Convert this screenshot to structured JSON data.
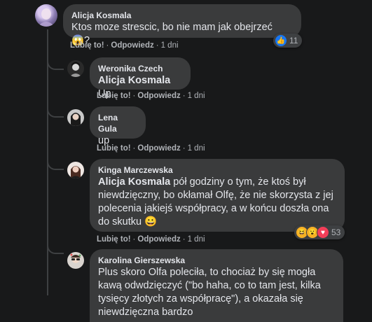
{
  "comments": [
    {
      "author": "Alicja Kosmala",
      "mention": "",
      "text": "Ktos moze strescic, bo nie mam jak obejrzeć 😱?",
      "like": "Lubię to!",
      "reply": "Odpowiedz",
      "time": "1 dni",
      "reactions": {
        "count": "11",
        "icons": [
          "like-icon"
        ]
      }
    },
    {
      "author": "Weronika Czech",
      "mention": "Alicja Kosmala",
      "text": "Up",
      "like": "Lubię to!",
      "reply": "Odpowiedz",
      "time": "1 dni"
    },
    {
      "author": "Lena Gula",
      "mention": "",
      "text": "up",
      "like": "Lubię to!",
      "reply": "Odpowiedz",
      "time": "1 dni"
    },
    {
      "author": "Kinga Marczewska",
      "mention": "Alicja Kosmala",
      "text": "pół godziny o tym, że ktoś był niewdzięczny, bo okłamał Olfę, że nie skorzysta z jej polecenia jakiejś współpracy, a w końcu doszła ona do skutku 😀",
      "like": "Lubię to!",
      "reply": "Odpowiedz",
      "time": "1 dni",
      "reactions": {
        "count": "53",
        "icons": [
          "haha-icon",
          "wow-icon",
          "love-icon"
        ]
      }
    },
    {
      "author": "Karolina Gierszewska",
      "mention": "",
      "text": "Plus skoro Olfa poleciła, to chociaż by się mogła kawą odwdzięczyć (\"bo haha, co to tam jest, kilka tysięcy złotych za współpracę\"), a okazała się niewdzięczna bardzo"
    }
  ],
  "colors": {
    "background": "#18191a",
    "bubble": "#3a3b3c",
    "text": "#e4e6eb",
    "secondary": "#b0b3b8",
    "like_blue": "#1877f2"
  }
}
